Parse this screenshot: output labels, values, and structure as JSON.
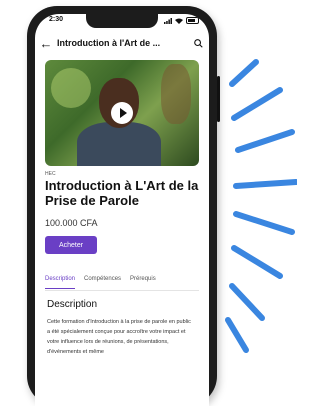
{
  "status_bar": {
    "time": "2:30"
  },
  "header": {
    "title": "Introduction à l'Art de ..."
  },
  "course": {
    "org": "HEC",
    "title": "Introduction à L'Art de la Prise de Parole",
    "price": "100.000 CFA",
    "buy_label": "Acheter"
  },
  "tabs": [
    {
      "label": "Description",
      "active": true
    },
    {
      "label": "Compétences",
      "active": false
    },
    {
      "label": "Prérequis",
      "active": false
    }
  ],
  "description": {
    "heading": "Description",
    "body": "Cette formation d'Introduction à la prise de parole en public a été spécialement conçue pour accroître votre impact et votre influence lors de réunions, de présentations, d'événements et même"
  },
  "colors": {
    "accent": "#6a3fc5",
    "rays": "#3a86e0"
  }
}
